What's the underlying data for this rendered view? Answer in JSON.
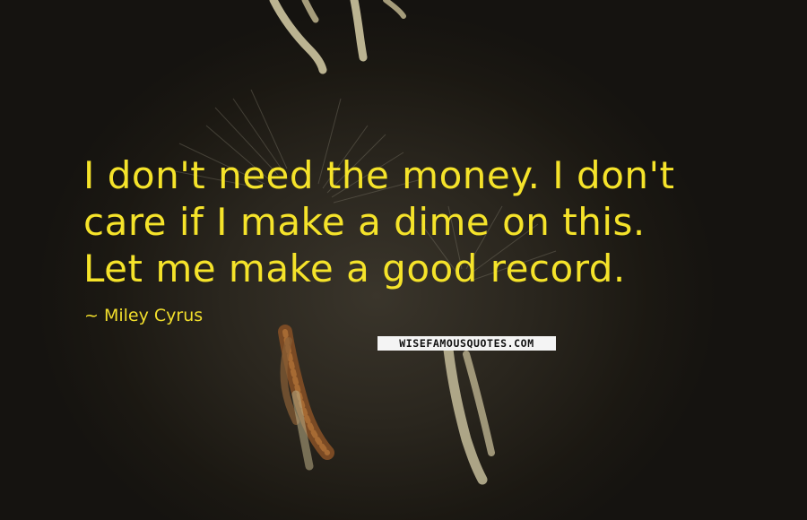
{
  "quote": {
    "lines": [
      "I don't need the money. I don't",
      "care if I make a dime on this.",
      "Let me make a good record."
    ]
  },
  "author": "~ Miley Cyrus",
  "watermark": "WISEFAMOUSQUOTES.COM",
  "colors": {
    "quote_text": "#f5e32a",
    "background": "#1d1a14"
  }
}
